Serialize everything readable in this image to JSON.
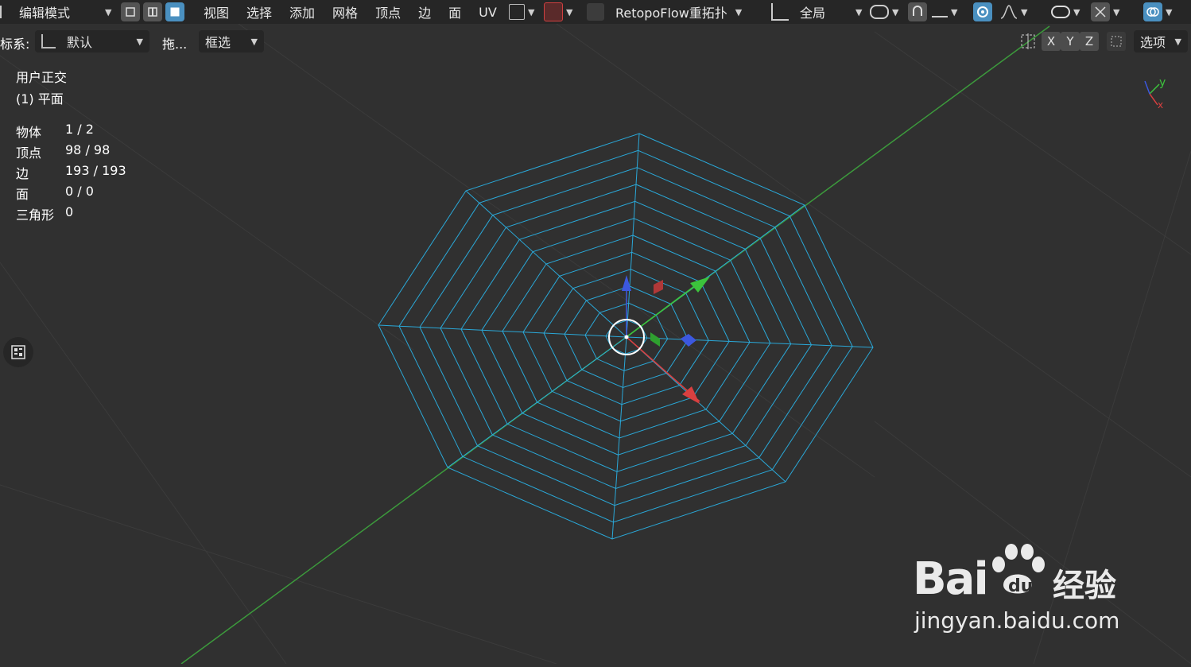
{
  "header": {
    "mode_label": "编辑模式",
    "menus": [
      "视图",
      "选择",
      "添加",
      "网格",
      "顶点",
      "边",
      "面",
      "UV"
    ],
    "retopo_label": "RetopoFlow重拓扑",
    "transform_space": "全局"
  },
  "toolbar2": {
    "orientation_label": "标系:",
    "orientation_value": "默认",
    "drag_label": "拖...",
    "select_mode": "框选",
    "axes": [
      "X",
      "Y",
      "Z"
    ],
    "options_label": "选项"
  },
  "overlay": {
    "view_name": "用户正交",
    "object_name": "(1) 平面",
    "stats": [
      {
        "key": "物体",
        "value": "1 / 2"
      },
      {
        "key": "顶点",
        "value": "98 / 98"
      },
      {
        "key": "边",
        "value": "193 / 193"
      },
      {
        "key": "面",
        "value": "0 / 0"
      },
      {
        "key": "三角形",
        "value": "0"
      }
    ]
  },
  "gizmo": {
    "y_label": "y",
    "x_label": "x"
  },
  "watermark": {
    "brand": "Bai",
    "brand_cn": "经验",
    "url": "jingyan.baidu.com"
  },
  "colors": {
    "mesh_wire": "#2aa8d8",
    "axis_y_line": "#3c9a3c",
    "gizmo_x": "#d94040",
    "gizmo_y": "#3cc43c",
    "gizmo_z": "#3c58e0",
    "active_button": "#4a90c0"
  },
  "icons": [
    "mode-icon",
    "vertex-select-icon",
    "edge-select-icon",
    "face-select-icon",
    "retopoflow-icon",
    "transform-pivot-icon",
    "snap-icon",
    "proportional-icon",
    "visibility-icon",
    "overlay-icon",
    "sidebar-toggle-icon"
  ]
}
